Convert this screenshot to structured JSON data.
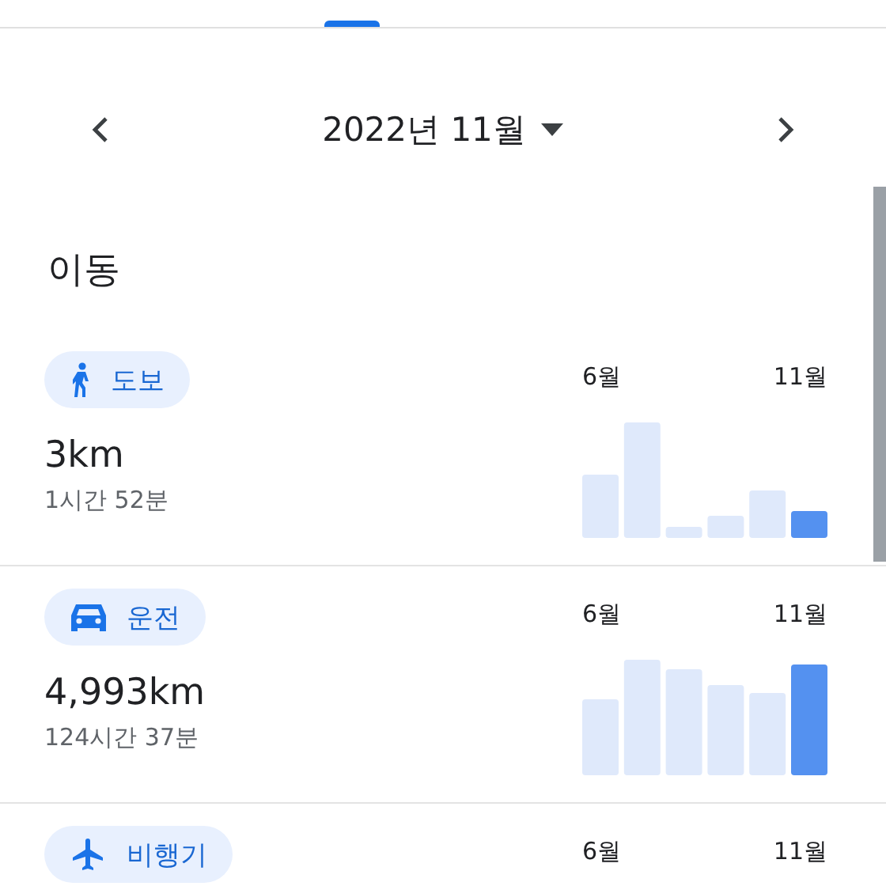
{
  "header": {
    "title": "2022년 11월"
  },
  "section_title": "이동",
  "activities": [
    {
      "kind": "walk",
      "label": "도보",
      "distance": "3km",
      "duration": "1시간 52분",
      "chart_start": "6월",
      "chart_end": "11월"
    },
    {
      "kind": "car",
      "label": "운전",
      "distance": "4,993km",
      "duration": "124시간 37분",
      "chart_start": "6월",
      "chart_end": "11월"
    },
    {
      "kind": "plane",
      "label": "비행기",
      "chart_start": "6월",
      "chart_end": "11월"
    }
  ]
}
